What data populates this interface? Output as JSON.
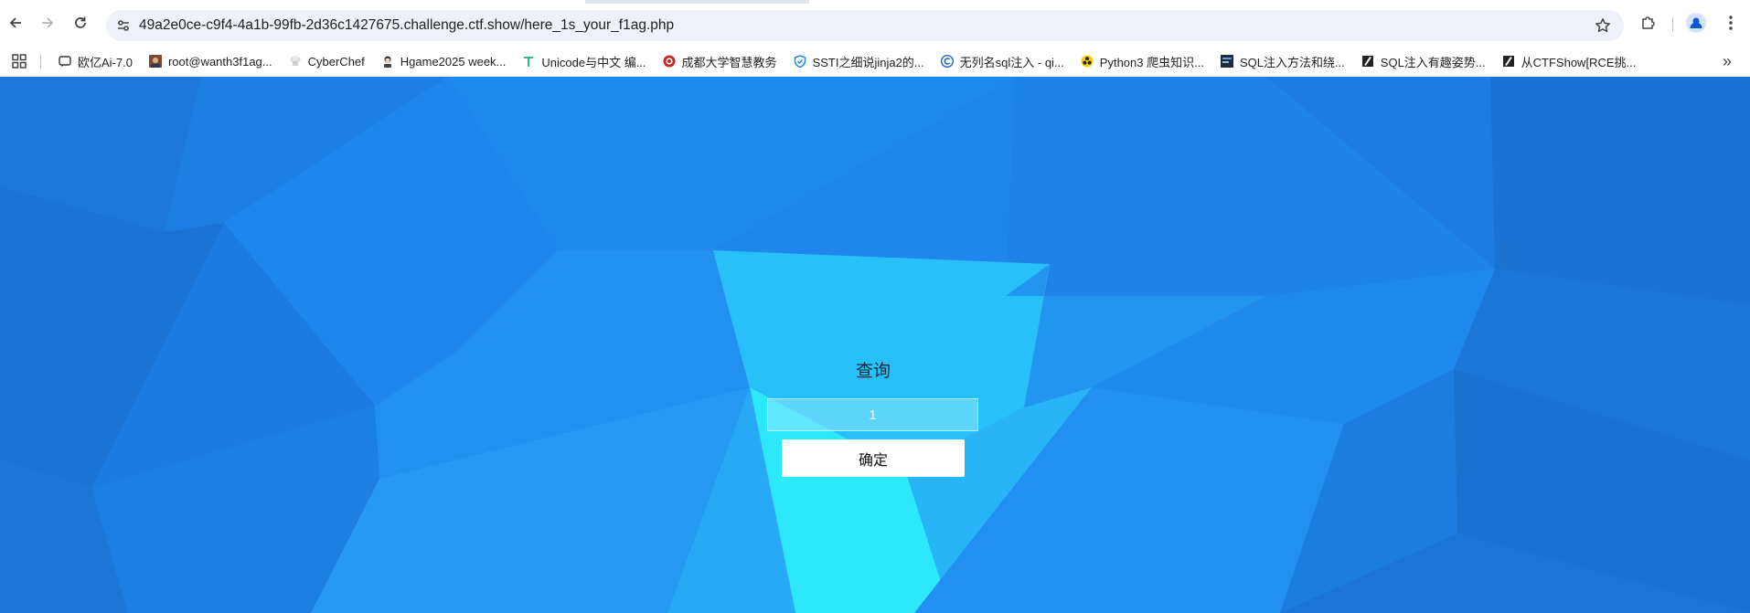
{
  "browser": {
    "url": "49a2e0ce-c9f4-4a1b-99fb-2d36c1427675.challenge.ctf.show/here_1s_your_f1ag.php",
    "bookmarks": [
      {
        "label": "欧亿Ai-7.0",
        "icon": "chat-icon"
      },
      {
        "label": "root@wanth3f1ag...",
        "icon": "avatar-icon"
      },
      {
        "label": "CyberChef",
        "icon": "chef-hat-icon"
      },
      {
        "label": "Hgame2025 week...",
        "icon": "person-icon"
      },
      {
        "label": "Unicode与中文 编...",
        "icon": "t-logo-icon"
      },
      {
        "label": "成都大学智慧教务",
        "icon": "university-icon"
      },
      {
        "label": "SSTI之细说jinja2的...",
        "icon": "shield-icon"
      },
      {
        "label": "无列名sql注入 - qi...",
        "icon": "circle-c-icon"
      },
      {
        "label": "Python3 爬虫知识...",
        "icon": "biohazard-icon"
      },
      {
        "label": "SQL注入方法和绕...",
        "icon": "thumbnail-icon"
      },
      {
        "label": "SQL注入有趣姿势...",
        "icon": "slash-logo-icon"
      },
      {
        "label": "从CTFShow[RCE挑...",
        "icon": "slash-logo-icon"
      }
    ]
  },
  "page": {
    "title": "查询",
    "input_placeholder": "1",
    "button_label": "确定"
  },
  "colors": {
    "background": "#1e80e6",
    "highlight": "#2cf0fb",
    "button": "#ffffff"
  }
}
